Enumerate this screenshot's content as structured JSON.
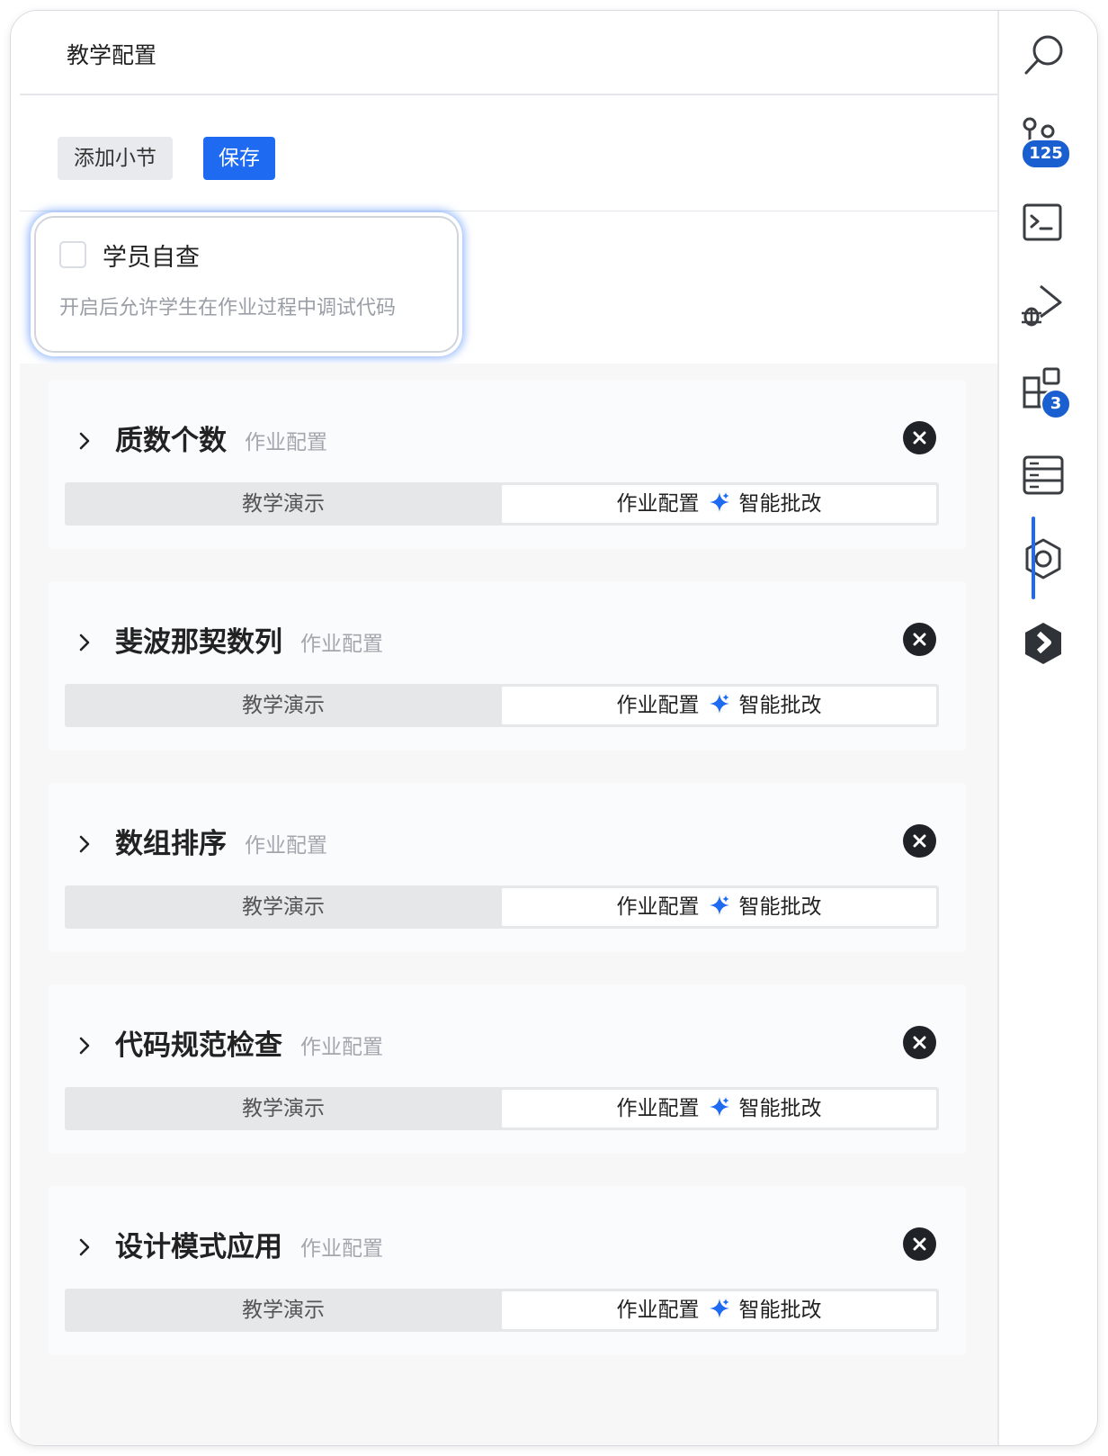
{
  "header": {
    "title": "教学配置"
  },
  "toolbar": {
    "add_label": "添加小节",
    "save_label": "保存"
  },
  "self_check": {
    "label": "学员自查",
    "description": "开启后允许学生在作业过程中调试代码",
    "checked": false
  },
  "sections": [
    {
      "title": "质数个数",
      "subtitle": "作业配置",
      "tab_left": "教学演示",
      "tab_right": "作业配置",
      "tab_ai": "智能批改"
    },
    {
      "title": "斐波那契数列",
      "subtitle": "作业配置",
      "tab_left": "教学演示",
      "tab_right": "作业配置",
      "tab_ai": "智能批改"
    },
    {
      "title": "数组排序",
      "subtitle": "作业配置",
      "tab_left": "教学演示",
      "tab_right": "作业配置",
      "tab_ai": "智能批改"
    },
    {
      "title": "代码规范检查",
      "subtitle": "作业配置",
      "tab_left": "教学演示",
      "tab_right": "作业配置",
      "tab_ai": "智能批改"
    },
    {
      "title": "设计模式应用",
      "subtitle": "作业配置",
      "tab_left": "教学演示",
      "tab_right": "作业配置",
      "tab_ai": "智能批改"
    }
  ],
  "sidebar": {
    "items": [
      {
        "icon": "search-icon"
      },
      {
        "icon": "source-control-icon",
        "badge": "125"
      },
      {
        "icon": "terminal-icon"
      },
      {
        "icon": "run-debug-icon"
      },
      {
        "icon": "extensions-icon",
        "badge": "3"
      },
      {
        "icon": "server-icon"
      },
      {
        "icon": "settings-hexagon-icon",
        "active": true
      },
      {
        "icon": "app-logo-icon"
      }
    ]
  },
  "colors": {
    "accent": "#1e6bf1",
    "badge": "#1a5fd0",
    "close": "#1f2227"
  }
}
